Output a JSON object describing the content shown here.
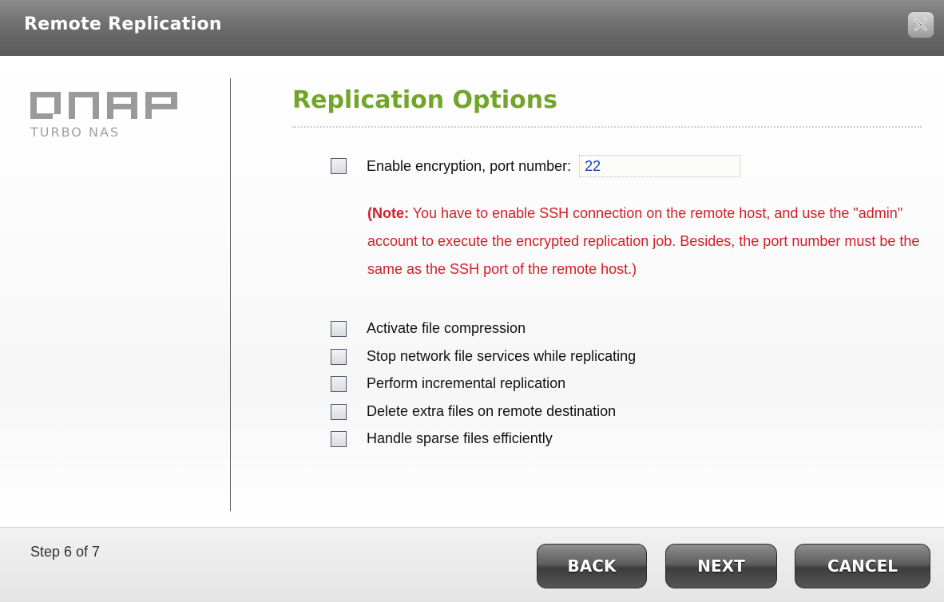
{
  "window": {
    "title": "Remote Replication",
    "close_icon": "close-icon"
  },
  "logo": {
    "brand": "QNAP",
    "subtitle": "TURBO NAS"
  },
  "section": {
    "title": "Replication Options"
  },
  "encryption": {
    "label": "Enable encryption, port number:",
    "port_value": "22",
    "checked": false
  },
  "note": {
    "prefix": "(Note:",
    "text": " You have to enable SSH connection on the remote host, and use the \"admin\" account to execute the encrypted replication job. Besides, the port number must be the same as the SSH port of the remote host.)"
  },
  "options": [
    {
      "label": "Activate file compression",
      "checked": false
    },
    {
      "label": "Stop network file services while replicating",
      "checked": false
    },
    {
      "label": "Perform incremental replication",
      "checked": false
    },
    {
      "label": "Delete extra files on remote destination",
      "checked": false
    },
    {
      "label": "Handle sparse files efficiently",
      "checked": false
    }
  ],
  "footer": {
    "step": "Step 6 of 7",
    "back_label": "BACK",
    "next_label": "NEXT",
    "cancel_label": "CANCEL"
  },
  "colors": {
    "accent_green": "#73a52c",
    "note_red": "#d0202a",
    "titlebar": "#6e6e6e"
  }
}
